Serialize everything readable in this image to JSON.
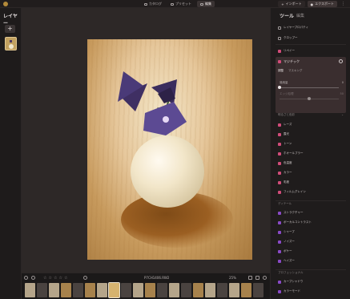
{
  "topbar": {
    "tabs": [
      {
        "label": "カタログ",
        "active": false
      },
      {
        "label": "プリセット",
        "active": false
      },
      {
        "label": "編集",
        "active": true
      }
    ],
    "import_label": "インポート",
    "export_label": "エクスポート"
  },
  "left_panel": {
    "title": "レイヤー",
    "add_glyph": "+"
  },
  "canvas": {
    "filename": "P7CH1406.RW2",
    "zoom": "25%"
  },
  "right_panel": {
    "title": "ツール",
    "subtitle": "編集",
    "items_top": [
      {
        "label": "レイヤープロパティ"
      },
      {
        "label": "クロップー"
      },
      {
        "label": "リペイー"
      }
    ],
    "active_tool": {
      "label": "マジチック",
      "tabs": [
        "調整",
        "マスキング"
      ],
      "slider1_label": "適用量",
      "slider1_value": "0",
      "slider2_label": "エッジ処理",
      "slider2_value": "50",
      "slider1_level": 0,
      "slider2_level": 0.5
    },
    "section1": "明るさと色彩",
    "items_mid": [
      {
        "label": "レーズ",
        "color": "pink"
      },
      {
        "label": "露光",
        "color": "pink"
      },
      {
        "label": "トーン",
        "color": "pink"
      },
      {
        "label": "ホオールブラー",
        "color": "pink"
      },
      {
        "label": "色温度",
        "color": "pink"
      },
      {
        "label": "カラー",
        "color": "pink"
      },
      {
        "label": "彩度",
        "color": "pink"
      },
      {
        "label": "フィルムグレイン",
        "color": "pink"
      }
    ],
    "section2": "ディテール",
    "items_detail": [
      {
        "label": "ストラクチャー",
        "color": "purple"
      },
      {
        "label": "ボーカルコントラスト",
        "color": "purple"
      },
      {
        "label": "シャープ",
        "color": "purple"
      },
      {
        "label": "ノイズー",
        "color": "purple"
      },
      {
        "label": "ボケー",
        "color": "purple"
      },
      {
        "label": "ヘイズー",
        "color": "purple"
      }
    ],
    "section3": "プロフェッショナル",
    "items_pro": [
      {
        "label": "カーブシャドウ",
        "color": "purple"
      },
      {
        "label": "カラーモード",
        "color": "purple"
      }
    ]
  },
  "bottom": {
    "stars": [
      "☆",
      "☆",
      "☆",
      "☆",
      "☆"
    ]
  }
}
